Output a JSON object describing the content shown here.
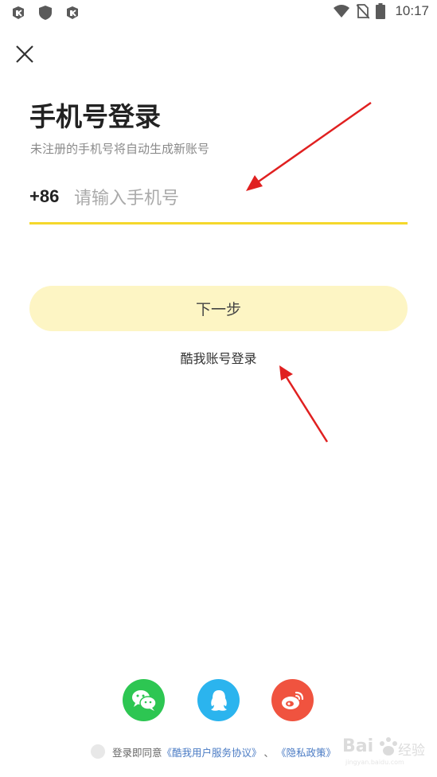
{
  "status_bar": {
    "time": "10:17",
    "left_icons": [
      "game-icon",
      "shield-icon",
      "game-icon"
    ],
    "right_icons": [
      "wifi-icon",
      "no-sim-icon",
      "battery-icon"
    ]
  },
  "header": {
    "close_icon": "close-icon"
  },
  "login": {
    "title": "手机号登录",
    "subtitle": "未注册的手机号将自动生成新账号",
    "country_code": "+86",
    "phone_placeholder": "请输入手机号",
    "phone_value": "",
    "next_button": "下一步",
    "alt_login": "酷我账号登录"
  },
  "social": [
    {
      "name": "wechat",
      "icon": "wechat-icon",
      "color": "#2dc652"
    },
    {
      "name": "qq",
      "icon": "qq-icon",
      "color": "#2bb4ee"
    },
    {
      "name": "weibo",
      "icon": "weibo-icon",
      "color": "#f0533f"
    }
  ],
  "agreement": {
    "prefix": "登录即同意",
    "service_link": "《酷我用户服务协议》",
    "separator": "、",
    "privacy_link": "《隐私政策》"
  },
  "colors": {
    "accent_underline": "#f5d82b",
    "button_bg": "#fdf5c4",
    "link": "#4a7bc4",
    "annotation_arrow": "#e02020"
  },
  "watermark": {
    "text": "Bai 经验"
  }
}
